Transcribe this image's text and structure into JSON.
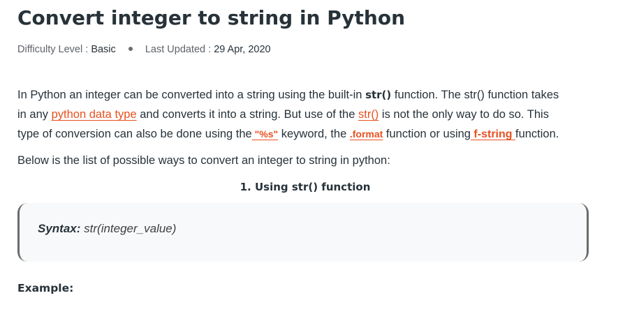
{
  "article": {
    "title": "Convert integer to string in Python",
    "meta": {
      "difficulty_label": "Difficulty Level : ",
      "difficulty_value": "Basic",
      "updated_label": "Last Updated : ",
      "updated_value": "29 Apr, 2020"
    },
    "intro": {
      "line1_a": "In Python an integer can be converted into a string using the built-in ",
      "line1_code": "str()",
      "line1_b": " function. The str() function takes",
      "line2_a": "in any ",
      "line2_link1": "python data type",
      "line2_b": " and converts it into a string. But use of the ",
      "line2_link2": "str()",
      "line2_c": " is not the only way to do so. This",
      "line3_a": "type of conversion can also be done using the",
      "line3_link1": " \"%s\"",
      "line3_b": " keyword, the ",
      "line3_link2": ".format",
      "line3_c": " function or using",
      "line3_link3": " f-string ",
      "line3_d": "function."
    },
    "list_intro": "Below is the list of possible ways to convert an integer to string in python:",
    "section_heading": "1. Using str() function",
    "syntax": {
      "label": "Syntax:",
      "value": " str(integer_value)"
    },
    "example_label": "Example:"
  }
}
